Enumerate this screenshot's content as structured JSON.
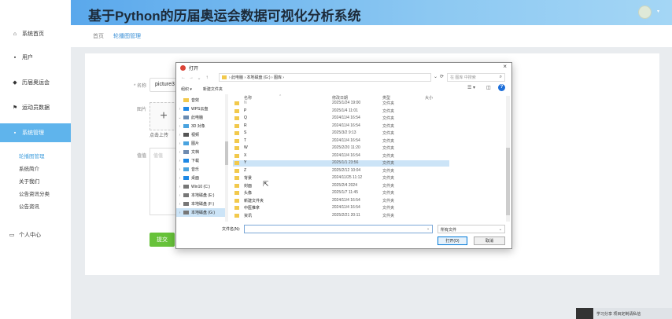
{
  "header": {
    "title": "基于Python的历届奥运会数据可视化分析系统"
  },
  "sidebar": {
    "items": [
      {
        "icon": "⌂",
        "label": "系统首页"
      },
      {
        "icon": "▪",
        "label": "用户"
      },
      {
        "icon": "◆",
        "label": "历届奥运会"
      },
      {
        "icon": "⚑",
        "label": "运动员数据"
      },
      {
        "icon": "▪",
        "label": "系统管理"
      }
    ],
    "subitems": [
      "轮播图管理",
      "系统简介",
      "关于我们",
      "公告资讯分类",
      "公告资讯"
    ],
    "extra": {
      "icon": "▭",
      "label": "个人中心"
    }
  },
  "breadcrumb": {
    "home": "首页",
    "current": "轮播图管理"
  },
  "form": {
    "name_label": "* 名称",
    "name_value": "picture3",
    "image_label": "图片",
    "upload_hint": "点击上传",
    "content_label": "值值",
    "content_placeholder": "值值",
    "submit_label": "提交"
  },
  "dialog": {
    "title": "打开",
    "nav_back": "←",
    "nav_forward": "→",
    "nav_up_dropdown": "⌄",
    "nav_up": "↑",
    "address": "› 此电脑 › 本地磁盘 (G:) › 图库 ›",
    "refresh": "⟳",
    "search_placeholder": "在 图库 中搜索",
    "organize": "组织 ▾",
    "new_folder": "新建文件夹",
    "view_icon": "☰ ▾",
    "pane_icon": "◫",
    "help": "?",
    "tree": [
      {
        "caret": "",
        "label": "音效",
        "color": "#f2c94c"
      },
      {
        "caret": "›",
        "label": "WPS云盘",
        "color": "#1e88e5"
      },
      {
        "caret": "⌄",
        "label": "此电脑",
        "color": "#6a8cb3"
      },
      {
        "caret": "›",
        "label": "3D 对象",
        "color": "#4aa3df"
      },
      {
        "caret": "›",
        "label": "视频",
        "color": "#555555"
      },
      {
        "caret": "›",
        "label": "图片",
        "color": "#4aa3df"
      },
      {
        "caret": "›",
        "label": "文档",
        "color": "#6f8bb0"
      },
      {
        "caret": "›",
        "label": "下载",
        "color": "#1e88e5"
      },
      {
        "caret": "›",
        "label": "音乐",
        "color": "#4aa3df"
      },
      {
        "caret": "›",
        "label": "桌面",
        "color": "#1e88e5"
      },
      {
        "caret": "›",
        "label": "Win10 (C:)",
        "color": "#777777"
      },
      {
        "caret": "›",
        "label": "本地磁盘 (E:)",
        "color": "#777777"
      },
      {
        "caret": "›",
        "label": "本地磁盘 (F:)",
        "color": "#777777"
      },
      {
        "caret": "›",
        "label": "本地磁盘 (G:)",
        "color": "#777777"
      }
    ],
    "columns": {
      "name": "名称",
      "date": "修改日期",
      "type": "类型",
      "size": "大小"
    },
    "rows": [
      {
        "name": "N",
        "date": "2025/1/24 19:00",
        "type": "文件夹",
        "state": "dim"
      },
      {
        "name": "P",
        "date": "2025/1/4 11:01",
        "type": "文件夹",
        "state": ""
      },
      {
        "name": "Q",
        "date": "2024/11/4 16:54",
        "type": "文件夹",
        "state": ""
      },
      {
        "name": "R",
        "date": "2024/11/4 16:54",
        "type": "文件夹",
        "state": ""
      },
      {
        "name": "S",
        "date": "2025/3/2 9:13",
        "type": "文件夹",
        "state": ""
      },
      {
        "name": "T",
        "date": "2024/11/4 16:54",
        "type": "文件夹",
        "state": ""
      },
      {
        "name": "W",
        "date": "2025/2/20 11:20",
        "type": "文件夹",
        "state": ""
      },
      {
        "name": "X",
        "date": "2024/11/4 16:54",
        "type": "文件夹",
        "state": ""
      },
      {
        "name": "Y",
        "date": "2025/1/1 23:56",
        "type": "文件夹",
        "state": "sel"
      },
      {
        "name": "Z",
        "date": "2025/2/12 10:04",
        "type": "文件夹",
        "state": ""
      },
      {
        "name": "背景",
        "date": "2024/11/25 11:12",
        "type": "文件夹",
        "state": ""
      },
      {
        "name": "封面",
        "date": "2025/2/4 2024",
        "type": "文件夹",
        "state": ""
      },
      {
        "name": "头像",
        "date": "2025/1/7 11:45",
        "type": "文件夹",
        "state": ""
      },
      {
        "name": "新建文件夹",
        "date": "2024/11/4 16:54",
        "type": "文件夹",
        "state": ""
      },
      {
        "name": "中医推拿",
        "date": "2024/11/4 16:54",
        "type": "文件夹",
        "state": ""
      },
      {
        "name": "资讯",
        "date": "2025/2/21 20:11",
        "type": "文件夹",
        "state": ""
      }
    ],
    "filename_label": "文件名(N):",
    "filename_value": "",
    "filetype": "所有文件",
    "open_button": "打开(O)",
    "cancel_button": "取消",
    "close": "×"
  },
  "corner": {
    "text": "学习分享 项目定制请私信"
  }
}
